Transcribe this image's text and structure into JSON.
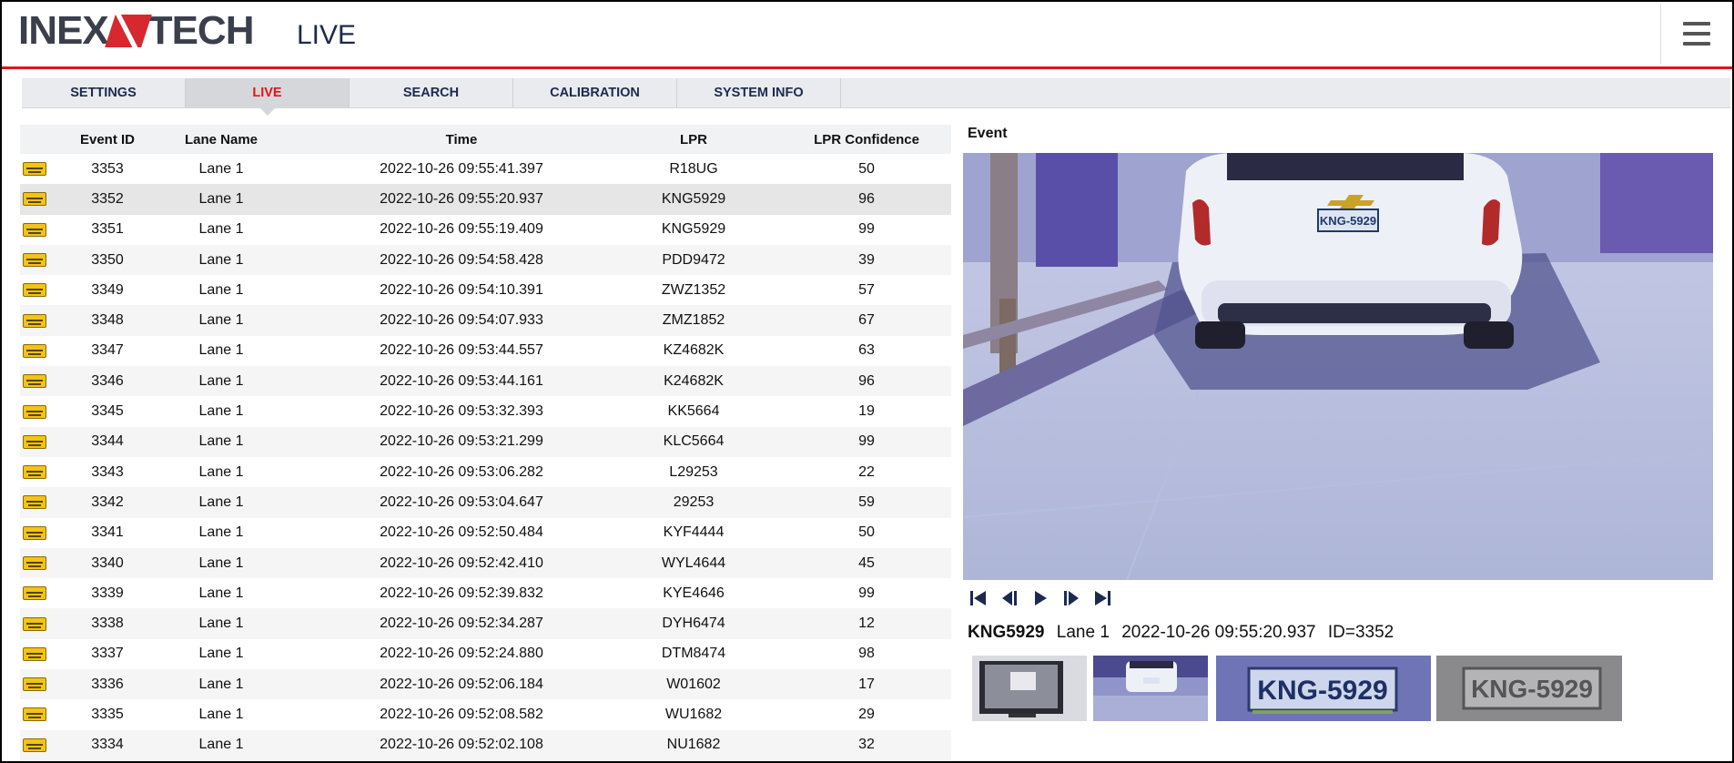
{
  "header": {
    "logo_text_left": "INEX",
    "logo_text_right": "TECH",
    "title": "LIVE",
    "menu_icon": "hamburger-menu-icon"
  },
  "tabs": [
    {
      "label": "SETTINGS",
      "active": false
    },
    {
      "label": "LIVE",
      "active": true
    },
    {
      "label": "SEARCH",
      "active": false
    },
    {
      "label": "CALIBRATION",
      "active": false
    },
    {
      "label": "SYSTEM INFO",
      "active": false
    }
  ],
  "table": {
    "columns": [
      "Event ID",
      "Lane Name",
      "Time",
      "LPR",
      "LPR Confidence"
    ],
    "row_icon": "license-plate-icon",
    "selected_event_id": "3352",
    "rows": [
      {
        "id": "3353",
        "lane": "Lane 1",
        "time": "2022-10-26 09:55:41.397",
        "lpr": "R18UG",
        "conf": "50"
      },
      {
        "id": "3352",
        "lane": "Lane 1",
        "time": "2022-10-26 09:55:20.937",
        "lpr": "KNG5929",
        "conf": "96"
      },
      {
        "id": "3351",
        "lane": "Lane 1",
        "time": "2022-10-26 09:55:19.409",
        "lpr": "KNG5929",
        "conf": "99"
      },
      {
        "id": "3350",
        "lane": "Lane 1",
        "time": "2022-10-26 09:54:58.428",
        "lpr": "PDD9472",
        "conf": "39"
      },
      {
        "id": "3349",
        "lane": "Lane 1",
        "time": "2022-10-26 09:54:10.391",
        "lpr": "ZWZ1352",
        "conf": "57"
      },
      {
        "id": "3348",
        "lane": "Lane 1",
        "time": "2022-10-26 09:54:07.933",
        "lpr": "ZMZ1852",
        "conf": "67"
      },
      {
        "id": "3347",
        "lane": "Lane 1",
        "time": "2022-10-26 09:53:44.557",
        "lpr": "KZ4682K",
        "conf": "63"
      },
      {
        "id": "3346",
        "lane": "Lane 1",
        "time": "2022-10-26 09:53:44.161",
        "lpr": "K24682K",
        "conf": "96"
      },
      {
        "id": "3345",
        "lane": "Lane 1",
        "time": "2022-10-26 09:53:32.393",
        "lpr": "KK5664",
        "conf": "19"
      },
      {
        "id": "3344",
        "lane": "Lane 1",
        "time": "2022-10-26 09:53:21.299",
        "lpr": "KLC5664",
        "conf": "99"
      },
      {
        "id": "3343",
        "lane": "Lane 1",
        "time": "2022-10-26 09:53:06.282",
        "lpr": "L29253",
        "conf": "22"
      },
      {
        "id": "3342",
        "lane": "Lane 1",
        "time": "2022-10-26 09:53:04.647",
        "lpr": "29253",
        "conf": "59"
      },
      {
        "id": "3341",
        "lane": "Lane 1",
        "time": "2022-10-26 09:52:50.484",
        "lpr": "KYF4444",
        "conf": "50"
      },
      {
        "id": "3340",
        "lane": "Lane 1",
        "time": "2022-10-26 09:52:42.410",
        "lpr": "WYL4644",
        "conf": "45"
      },
      {
        "id": "3339",
        "lane": "Lane 1",
        "time": "2022-10-26 09:52:39.832",
        "lpr": "KYE4646",
        "conf": "99"
      },
      {
        "id": "3338",
        "lane": "Lane 1",
        "time": "2022-10-26 09:52:34.287",
        "lpr": "DYH6474",
        "conf": "12"
      },
      {
        "id": "3337",
        "lane": "Lane 1",
        "time": "2022-10-26 09:52:24.880",
        "lpr": "DTM8474",
        "conf": "98"
      },
      {
        "id": "3336",
        "lane": "Lane 1",
        "time": "2022-10-26 09:52:06.184",
        "lpr": "W01602",
        "conf": "17"
      },
      {
        "id": "3335",
        "lane": "Lane 1",
        "time": "2022-10-26 09:52:08.582",
        "lpr": "WU1682",
        "conf": "29"
      },
      {
        "id": "3334",
        "lane": "Lane 1",
        "time": "2022-10-26 09:52:02.108",
        "lpr": "NU1682",
        "conf": "32"
      }
    ]
  },
  "event": {
    "label": "Event",
    "plate_in_image": "KNG-5929",
    "plate": "KNG5929",
    "lane": "Lane 1",
    "time": "2022-10-26 09:55:20.937",
    "id_text": "ID=3352",
    "controls": [
      "skip-to-start-icon",
      "step-back-icon",
      "play-icon",
      "step-forward-icon",
      "skip-to-end-icon"
    ],
    "thumbnails": [
      "overview-thumbnail",
      "vehicle-thumbnail",
      "plate-color-thumbnail",
      "plate-gray-thumbnail"
    ]
  },
  "colors": {
    "accent_red": "#e1151b",
    "navy": "#1c2a4d",
    "plate_yellow": "#f2c318"
  }
}
